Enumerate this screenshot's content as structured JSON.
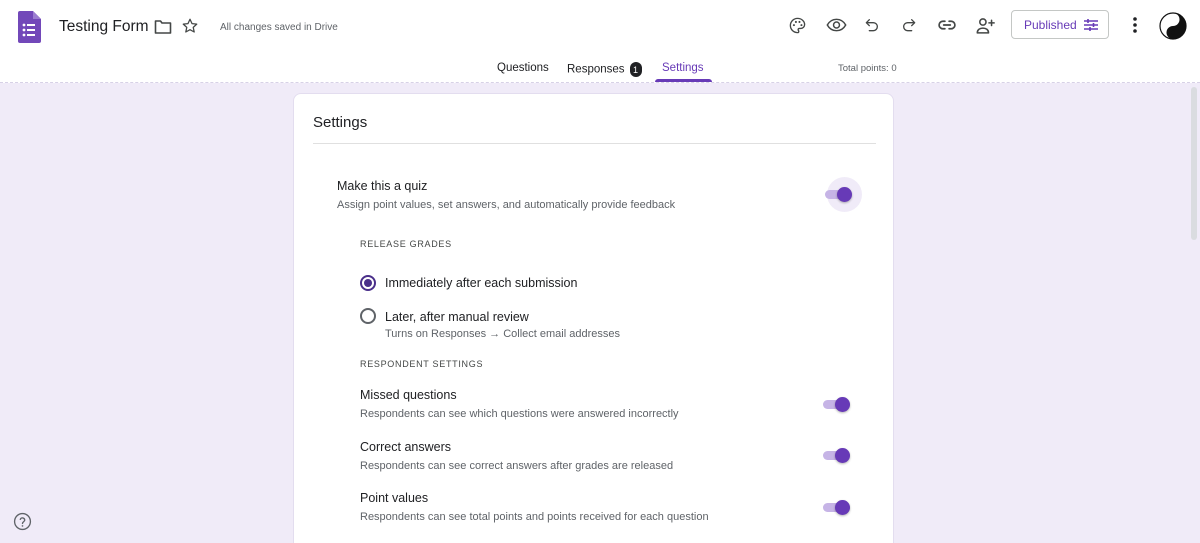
{
  "header": {
    "doc_title": "Testing Form",
    "saved_status": "All changes saved in Drive",
    "published_label": "Published",
    "icons": [
      "forms-logo-icon",
      "folder-icon",
      "star-icon",
      "palette-icon",
      "preview-eye-icon",
      "undo-icon",
      "redo-icon",
      "link-icon",
      "add-collaborator-icon",
      "tune-icon",
      "more-vert-icon",
      "avatar-yin-yang"
    ]
  },
  "tabs": {
    "questions": "Questions",
    "responses": "Responses",
    "responses_badge": "1",
    "settings": "Settings",
    "active": "Settings",
    "total_points": "Total points: 0"
  },
  "settings": {
    "title": "Settings",
    "quiz": {
      "title": "Make this a quiz",
      "description": "Assign point values, set answers, and automatically provide feedback",
      "enabled": true
    },
    "release_grades": {
      "heading": "RELEASE GRADES",
      "options": [
        {
          "label": "Immediately after each submission",
          "sub": "",
          "selected": true
        },
        {
          "label": "Later, after manual review",
          "sub": "Turns on Responses → Collect email addresses",
          "selected": false
        }
      ]
    },
    "respondent_settings": {
      "heading": "RESPONDENT SETTINGS",
      "items": [
        {
          "title": "Missed questions",
          "description": "Respondents can see which questions were answered incorrectly",
          "enabled": true
        },
        {
          "title": "Correct answers",
          "description": "Respondents can see correct answers after grades are released",
          "enabled": true
        },
        {
          "title": "Point values",
          "description": "Respondents can see total points and points received for each question",
          "enabled": true
        }
      ]
    }
  },
  "colors": {
    "accent": "#673ab7",
    "background": "#f0ebf8",
    "logo": "#7248b9"
  }
}
